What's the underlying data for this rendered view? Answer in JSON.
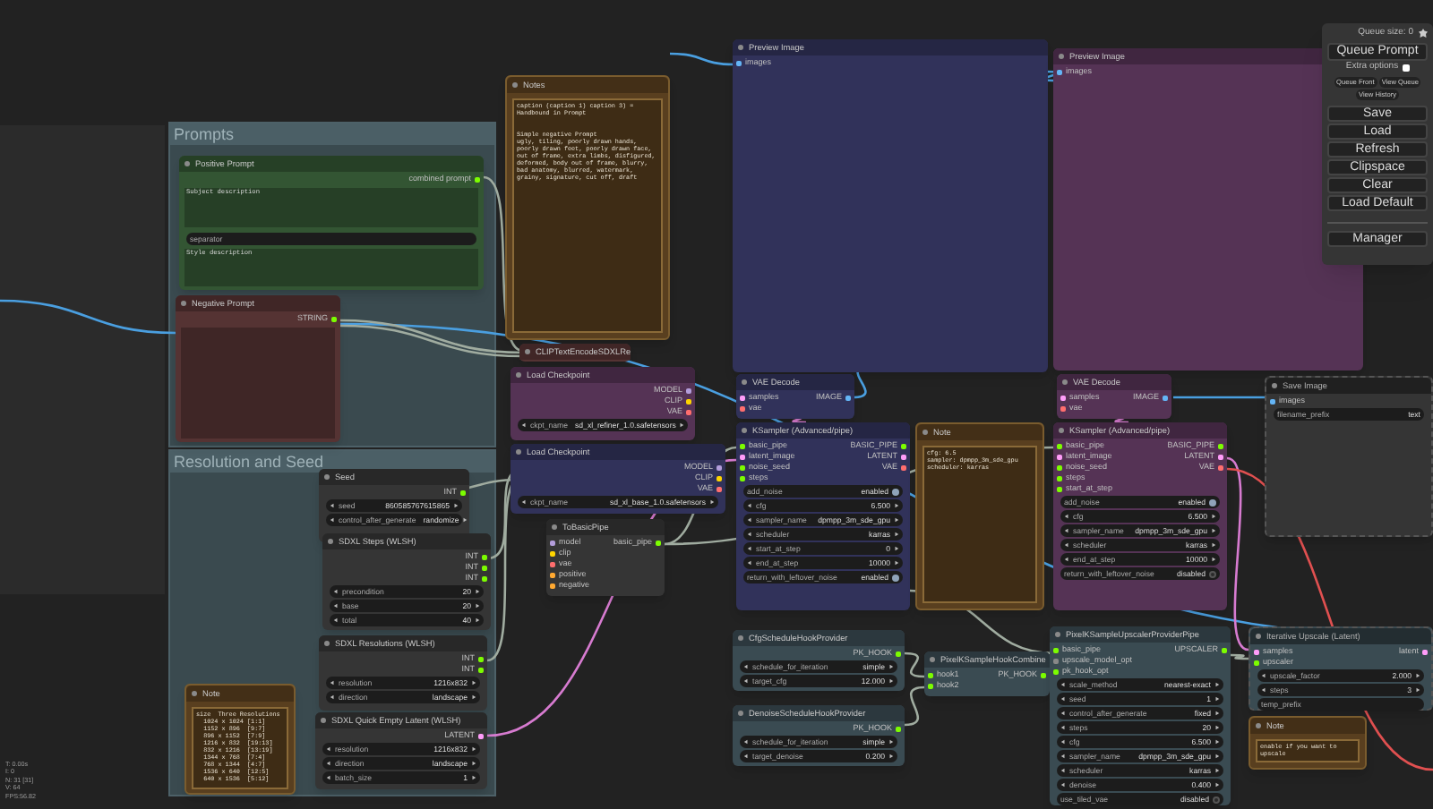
{
  "groups": [
    {
      "title": "Prompts"
    },
    {
      "title": "Resolution and Seed"
    }
  ],
  "nodes": [
    {
      "kind": "note",
      "title": "Notes",
      "color": "#593f1f",
      "text": "caption (caption 1) caption 3) = Handbound in Prompt\n\n\nSimple negative Prompt\nugly, tiling, poorly drawn hands, poorly drawn feet, poorly drawn face, out of frame, extra limbs, disfigured, deformed, body out of frame, blurry, bad anatomy, blurred, watermark, grainy, signature, cut off, draft"
    },
    {
      "kind": "node",
      "title": "Preview Image",
      "color": "#31325a",
      "inputs": [
        {
          "name": "images",
          "color": "#64b5f6"
        }
      ]
    },
    {
      "kind": "node",
      "title": "Preview Image",
      "color": "#553355",
      "inputs": [
        {
          "name": "images",
          "color": "#64b5f6"
        }
      ]
    },
    {
      "kind": "node",
      "title": "Positive Prompt",
      "color": "#335533",
      "outputs": [
        {
          "name": "combined prompt",
          "color": "#7cfc00"
        }
      ],
      "widgets": [
        {
          "kind": "textarea",
          "value": "Subject description"
        },
        {
          "kind": "text",
          "name": "separator"
        },
        {
          "kind": "textarea",
          "value": "Style description"
        }
      ]
    },
    {
      "kind": "node",
      "title": "Negative Prompt",
      "color": "#553333",
      "outputs": [
        {
          "name": "STRING",
          "color": "#7cfc00"
        }
      ],
      "widgets": [
        {
          "kind": "textarea"
        }
      ]
    },
    {
      "kind": "node",
      "title": "CLIPTextEncodeSDXLRe",
      "color": "#553333"
    },
    {
      "kind": "node",
      "title": "Load Checkpoint",
      "color": "#553355",
      "outputs": [
        {
          "name": "MODEL",
          "color": "#b39ddb"
        },
        {
          "name": "CLIP",
          "color": "#ffd500"
        },
        {
          "name": "VAE",
          "color": "#ff6e6e"
        }
      ],
      "widgets": [
        {
          "kind": "combo",
          "name": "ckpt_name",
          "value": "sd_xl_refiner_1.0.safetensors"
        }
      ]
    },
    {
      "kind": "node",
      "title": "VAE Decode",
      "color": "#31325a",
      "inputs": [
        {
          "name": "samples",
          "color": "#ff9cf9"
        },
        {
          "name": "vae",
          "color": "#ff6e6e"
        }
      ],
      "outputs": [
        {
          "name": "IMAGE",
          "color": "#64b5f6"
        }
      ]
    },
    {
      "kind": "node",
      "title": "VAE Decode",
      "color": "#553355",
      "inputs": [
        {
          "name": "samples",
          "color": "#ff9cf9"
        },
        {
          "name": "vae",
          "color": "#ff6e6e"
        }
      ],
      "outputs": [
        {
          "name": "IMAGE",
          "color": "#64b5f6"
        }
      ]
    },
    {
      "kind": "node",
      "title": "Save Image",
      "color": "#353535",
      "muted": true,
      "inputs": [
        {
          "name": "images",
          "color": "#64b5f6"
        }
      ],
      "widgets": [
        {
          "kind": "text",
          "name": "filename_prefix",
          "value": "text"
        }
      ]
    },
    {
      "kind": "node",
      "title": "Seed",
      "color": "#353535",
      "outputs": [
        {
          "name": "INT",
          "color": "#7cfc00"
        }
      ],
      "widgets": [
        {
          "kind": "number",
          "name": "seed",
          "value": "860585767615865"
        },
        {
          "kind": "combo",
          "name": "control_after_generate",
          "value": "randomize"
        }
      ]
    },
    {
      "kind": "node",
      "title": "Load Checkpoint",
      "color": "#31325a",
      "outputs": [
        {
          "name": "MODEL",
          "color": "#b39ddb"
        },
        {
          "name": "CLIP",
          "color": "#ffd500"
        },
        {
          "name": "VAE",
          "color": "#ff6e6e"
        }
      ],
      "widgets": [
        {
          "kind": "combo",
          "name": "ckpt_name",
          "value": "sd_xl_base_1.0.safetensors"
        }
      ]
    },
    {
      "kind": "node",
      "title": "KSampler (Advanced/pipe)",
      "color": "#31325a",
      "inputs": [
        {
          "name": "basic_pipe",
          "color": "#7cfc00"
        },
        {
          "name": "latent_image",
          "color": "#ff9cf9"
        },
        {
          "name": "noise_seed",
          "color": "#7cfc00"
        },
        {
          "name": "steps",
          "color": "#7cfc00"
        }
      ],
      "outputs": [
        {
          "name": "BASIC_PIPE",
          "color": "#7cfc00"
        },
        {
          "name": "LATENT",
          "color": "#ff9cf9"
        },
        {
          "name": "VAE",
          "color": "#ff6e6e"
        }
      ],
      "widgets": [
        {
          "kind": "toggle",
          "name": "add_noise",
          "value": "enabled",
          "on": true
        },
        {
          "kind": "number",
          "name": "cfg",
          "value": "6.500"
        },
        {
          "kind": "combo",
          "name": "sampler_name",
          "value": "dpmpp_3m_sde_gpu"
        },
        {
          "kind": "combo",
          "name": "scheduler",
          "value": "karras"
        },
        {
          "kind": "number",
          "name": "start_at_step",
          "value": "0"
        },
        {
          "kind": "number",
          "name": "end_at_step",
          "value": "10000"
        },
        {
          "kind": "toggle",
          "name": "return_with_leftover_noise",
          "value": "enabled",
          "on": true
        }
      ]
    },
    {
      "kind": "note",
      "title": "Note",
      "color": "#593f1f",
      "text": "cfg: 6.5\nsampler: dpmpp_3m_sde_gpu\nscheduler: karras"
    },
    {
      "kind": "node",
      "title": "KSampler (Advanced/pipe)",
      "color": "#553355",
      "inputs": [
        {
          "name": "basic_pipe",
          "color": "#7cfc00"
        },
        {
          "name": "latent_image",
          "color": "#ff9cf9"
        },
        {
          "name": "noise_seed",
          "color": "#7cfc00"
        },
        {
          "name": "steps",
          "color": "#7cfc00"
        },
        {
          "name": "start_at_step",
          "color": "#7cfc00"
        }
      ],
      "outputs": [
        {
          "name": "BASIC_PIPE",
          "color": "#7cfc00"
        },
        {
          "name": "LATENT",
          "color": "#ff9cf9"
        },
        {
          "name": "VAE",
          "color": "#ff6e6e"
        }
      ],
      "widgets": [
        {
          "kind": "toggle",
          "name": "add_noise",
          "value": "enabled",
          "on": true
        },
        {
          "kind": "number",
          "name": "cfg",
          "value": "6.500"
        },
        {
          "kind": "combo",
          "name": "sampler_name",
          "value": "dpmpp_3m_sde_gpu"
        },
        {
          "kind": "combo",
          "name": "scheduler",
          "value": "karras"
        },
        {
          "kind": "number",
          "name": "end_at_step",
          "value": "10000"
        },
        {
          "kind": "toggle",
          "name": "return_with_leftover_noise",
          "value": "disabled",
          "on": false
        }
      ]
    },
    {
      "kind": "node",
      "title": "SDXL Steps (WLSH)",
      "color": "#353535",
      "outputs": [
        {
          "name": "INT",
          "color": "#7cfc00"
        },
        {
          "name": "INT",
          "color": "#7cfc00"
        },
        {
          "name": "INT",
          "color": "#7cfc00"
        }
      ],
      "widgets": [
        {
          "kind": "number",
          "name": "precondition",
          "value": "20"
        },
        {
          "kind": "number",
          "name": "base",
          "value": "20"
        },
        {
          "kind": "number",
          "name": "total",
          "value": "40"
        }
      ]
    },
    {
      "kind": "node",
      "title": "ToBasicPipe",
      "color": "#353535",
      "inputs": [
        {
          "name": "model",
          "color": "#b39ddb"
        },
        {
          "name": "clip",
          "color": "#ffd500"
        },
        {
          "name": "vae",
          "color": "#ff6e6e"
        },
        {
          "name": "positive",
          "color": "#ffa931"
        },
        {
          "name": "negative",
          "color": "#ffa931"
        }
      ],
      "outputs": [
        {
          "name": "basic_pipe",
          "color": "#7cfc00"
        }
      ]
    },
    {
      "kind": "node",
      "title": "SDXL Resolutions (WLSH)",
      "color": "#353535",
      "outputs": [
        {
          "name": "INT",
          "color": "#7cfc00"
        },
        {
          "name": "INT",
          "color": "#7cfc00"
        }
      ],
      "widgets": [
        {
          "kind": "combo",
          "name": "resolution",
          "value": "1216x832"
        },
        {
          "kind": "combo",
          "name": "direction",
          "value": "landscape"
        }
      ]
    },
    {
      "kind": "node",
      "title": "CfgScheduleHookProvider",
      "color": "#3a4b52",
      "outputs": [
        {
          "name": "PK_HOOK",
          "color": "#7cfc00"
        }
      ],
      "widgets": [
        {
          "kind": "combo",
          "name": "schedule_for_iteration",
          "value": "simple"
        },
        {
          "kind": "number",
          "name": "target_cfg",
          "value": "12.000"
        }
      ]
    },
    {
      "kind": "node",
      "title": "PixelKSampleHookCombine",
      "color": "#3a4b52",
      "inputs": [
        {
          "name": "hook1",
          "color": "#7cfc00"
        },
        {
          "name": "hook2",
          "color": "#7cfc00"
        }
      ],
      "outputs": [
        {
          "name": "PK_HOOK",
          "color": "#7cfc00"
        }
      ]
    },
    {
      "kind": "node",
      "title": "PixelKSampleUpscalerProviderPipe",
      "color": "#3a4b52",
      "inputs": [
        {
          "name": "basic_pipe",
          "color": "#7cfc00"
        },
        {
          "name": "upscale_model_opt",
          "color": "#888888"
        },
        {
          "name": "pk_hook_opt",
          "color": "#7cfc00"
        }
      ],
      "outputs": [
        {
          "name": "UPSCALER",
          "color": "#7cfc00"
        }
      ],
      "widgets": [
        {
          "kind": "combo",
          "name": "scale_method",
          "value": "nearest-exact"
        },
        {
          "kind": "number",
          "name": "seed",
          "value": "1"
        },
        {
          "kind": "combo",
          "name": "control_after_generate",
          "value": "fixed"
        },
        {
          "kind": "number",
          "name": "steps",
          "value": "20"
        },
        {
          "kind": "number",
          "name": "cfg",
          "value": "6.500"
        },
        {
          "kind": "combo",
          "name": "sampler_name",
          "value": "dpmpp_3m_sde_gpu"
        },
        {
          "kind": "combo",
          "name": "scheduler",
          "value": "karras"
        },
        {
          "kind": "number",
          "name": "denoise",
          "value": "0.400"
        },
        {
          "kind": "toggle",
          "name": "use_tiled_vae",
          "value": "disabled",
          "on": false
        }
      ]
    },
    {
      "kind": "node",
      "title": "Iterative Upscale (Latent)",
      "color": "#3a4b52",
      "muted": true,
      "inputs": [
        {
          "name": "samples",
          "color": "#ff9cf9"
        },
        {
          "name": "upscaler",
          "color": "#7cfc00"
        }
      ],
      "outputs": [
        {
          "name": "latent",
          "color": "#ff9cf9"
        }
      ],
      "widgets": [
        {
          "kind": "number",
          "name": "upscale_factor",
          "value": "2.000"
        },
        {
          "kind": "number",
          "name": "steps",
          "value": "3"
        },
        {
          "kind": "text",
          "name": "temp_prefix"
        }
      ]
    },
    {
      "kind": "note",
      "title": "Note",
      "color": "#593f1f",
      "text": "size  Three Resolutions\n  1024 x 1024 [1:1]\n  1152 x 896  [9:7]\n  896 x 1152  [7:9]\n  1216 x 832  [19:13]\n  832 x 1216  [13:19]\n  1344 x 768  [7:4]\n  768 x 1344  [4:7]\n  1536 x 640  [12:5]\n  640 x 1536  [5:12]"
    },
    {
      "kind": "node",
      "title": "SDXL Quick Empty Latent (WLSH)",
      "color": "#353535",
      "outputs": [
        {
          "name": "LATENT",
          "color": "#ff9cf9"
        }
      ],
      "widgets": [
        {
          "kind": "combo",
          "name": "resolution",
          "value": "1216x832"
        },
        {
          "kind": "combo",
          "name": "direction",
          "value": "landscape"
        },
        {
          "kind": "number",
          "name": "batch_size",
          "value": "1"
        }
      ]
    },
    {
      "kind": "node",
      "title": "DenoiseScheduleHookProvider",
      "color": "#3a4b52",
      "outputs": [
        {
          "name": "PK_HOOK",
          "color": "#7cfc00"
        }
      ],
      "widgets": [
        {
          "kind": "combo",
          "name": "schedule_for_iteration",
          "value": "simple"
        },
        {
          "kind": "number",
          "name": "target_denoise",
          "value": "0.200"
        }
      ]
    },
    {
      "kind": "note",
      "title": "Note",
      "color": "#593f1f",
      "text": "enable if you want to upscale"
    }
  ],
  "menu": {
    "queue_size": "Queue size: 0",
    "queue_button": "Queue Prompt",
    "extra_options": {
      "label": "Extra options",
      "checked": false
    },
    "small_buttons": [
      "Queue Front",
      "View Queue",
      "View History"
    ],
    "buttons": [
      "Save",
      "Load",
      "Refresh",
      "Clipspace",
      "Clear",
      "Load Default"
    ],
    "manager_button": "Manager"
  },
  "stats": [
    "T: 0.00s",
    "I: 0",
    "N: 31 [31]",
    "V: 64",
    "FPS:56.82"
  ]
}
